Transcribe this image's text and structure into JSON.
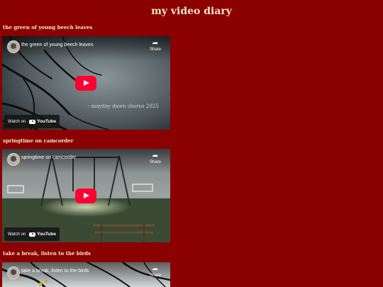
{
  "page": {
    "title": "my video diary"
  },
  "posts": [
    {
      "heading": "the green of young beech leaves",
      "video_title": "the green of young beech leaves",
      "overlay_text": "- mayday dawn chorus 2025",
      "share_label": "Share",
      "watch_label": "Watch on",
      "logo_text": "YouTube"
    },
    {
      "heading": "springtime on camcorder",
      "video_title": "springtime on camcorder",
      "share_label": "Share",
      "watch_label": "Watch on",
      "logo_text": "YouTube"
    },
    {
      "heading": "take a break, listen to the birds",
      "video_title": "take a break, listen to the birds",
      "share_label": "Share"
    }
  ],
  "colors": {
    "background": "#8b0000",
    "text": "#f3e7c8",
    "play_button": "#ff0033"
  }
}
